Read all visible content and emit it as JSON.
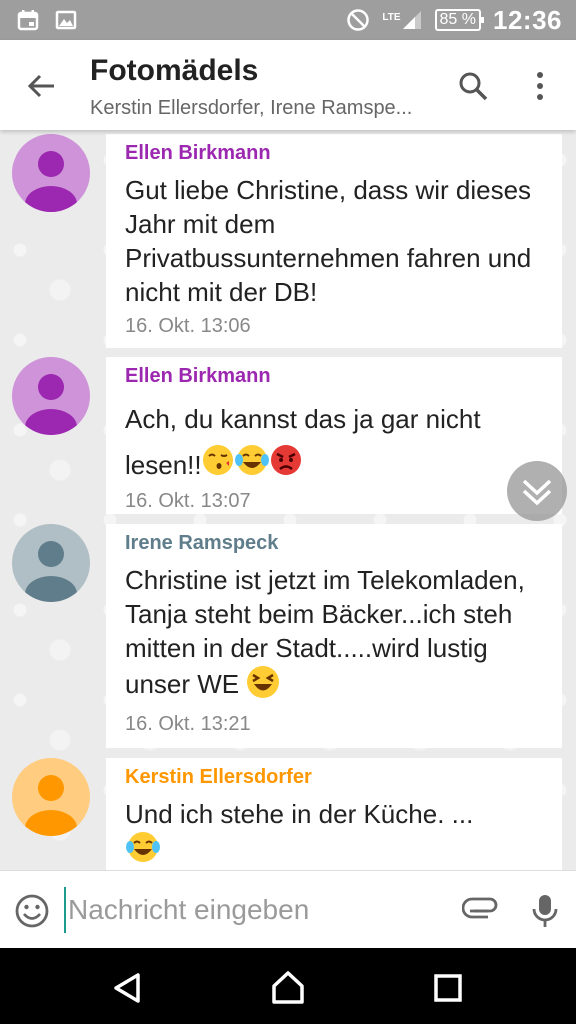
{
  "status_bar": {
    "network": "LTE",
    "battery": "85 %",
    "time": "12:36"
  },
  "header": {
    "title": "Fotomädels",
    "subtitle": "Kerstin Ellersdorfer, Irene Ramspe..."
  },
  "messages": [
    {
      "sender": "Ellen Birkmann",
      "sender_color": "#9c27b0",
      "avatar_color": "#ce93d8",
      "avatar_fg": "#9c27b0",
      "text": "Gut liebe Christine, dass wir dieses Jahr mit dem Privatbussunternehmen fahren und nicht mit der DB!",
      "time": "16. Okt. 13:06"
    },
    {
      "sender": "Ellen Birkmann",
      "sender_color": "#9c27b0",
      "avatar_color": "#ce93d8",
      "avatar_fg": "#9c27b0",
      "text": "Ach, du kannst das ja gar nicht lesen!!",
      "emojis": [
        "kissing-face-emoji",
        "tears-of-joy-emoji",
        "angry-face-emoji"
      ],
      "time": "16. Okt. 13:07"
    },
    {
      "sender": "Irene Ramspeck",
      "sender_color": "#607d8b",
      "avatar_color": "#b0bec5",
      "avatar_fg": "#607d8b",
      "text": "Christine ist jetzt im Telekomladen, Tanja steht beim Bäcker...ich steh mitten in der Stadt.....wird lustig unser WE",
      "emojis": [
        "laughing-face-emoji"
      ],
      "time": "16. Okt. 13:21"
    },
    {
      "sender": "Kerstin Ellersdorfer",
      "sender_color": "#ff9800",
      "avatar_color": "#ffcc80",
      "avatar_fg": "#ff9800",
      "text": "Und ich stehe in der Küche. ...",
      "emojis": [
        "tears-of-joy-emoji"
      ],
      "time": ""
    }
  ],
  "composer": {
    "placeholder": "Nachricht eingeben"
  },
  "icons": {
    "back": "arrow-left-icon",
    "search": "search-icon",
    "more": "more-vert-icon",
    "scroll": "chevron-double-down-icon",
    "emoji": "emoji-icon",
    "attach": "paperclip-icon",
    "mic": "microphone-icon"
  },
  "colors": {
    "status_bar": "#9e9e9e",
    "cursor": "#1a9d8f"
  }
}
